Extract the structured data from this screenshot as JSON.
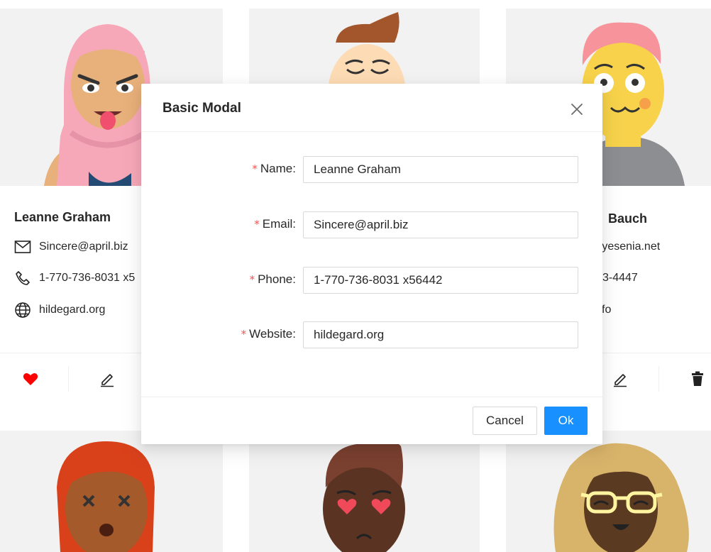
{
  "cards": [
    {
      "name": "Leanne Graham",
      "email": "Sincere@april.biz",
      "phone": "1-770-736-8031 x5",
      "website": "hildegard.org"
    },
    {
      "name": "Bauch",
      "email": ")yesenia.net",
      "phone": "3-4447",
      "website": "fo"
    }
  ],
  "modal": {
    "title": "Basic Modal",
    "fields": {
      "name": {
        "label": "Name",
        "value": "Leanne Graham"
      },
      "email": {
        "label": "Email",
        "value": "Sincere@april.biz"
      },
      "phone": {
        "label": "Phone",
        "value": "1-770-736-8031 x56442"
      },
      "website": {
        "label": "Website",
        "value": "hildegard.org"
      }
    },
    "required_mark": "*",
    "label_suffix": ":",
    "cancel_label": "Cancel",
    "ok_label": "Ok"
  },
  "icons": {
    "mail": "mail-icon",
    "phone": "phone-icon",
    "globe": "globe-icon",
    "heart": "heart-icon",
    "edit": "edit-icon",
    "delete": "delete-icon",
    "close": "close-icon"
  },
  "colors": {
    "primary": "#1890ff",
    "required": "#ff4d4f",
    "heart": "#ff0000",
    "avatar_bg": "#f2f2f2"
  }
}
